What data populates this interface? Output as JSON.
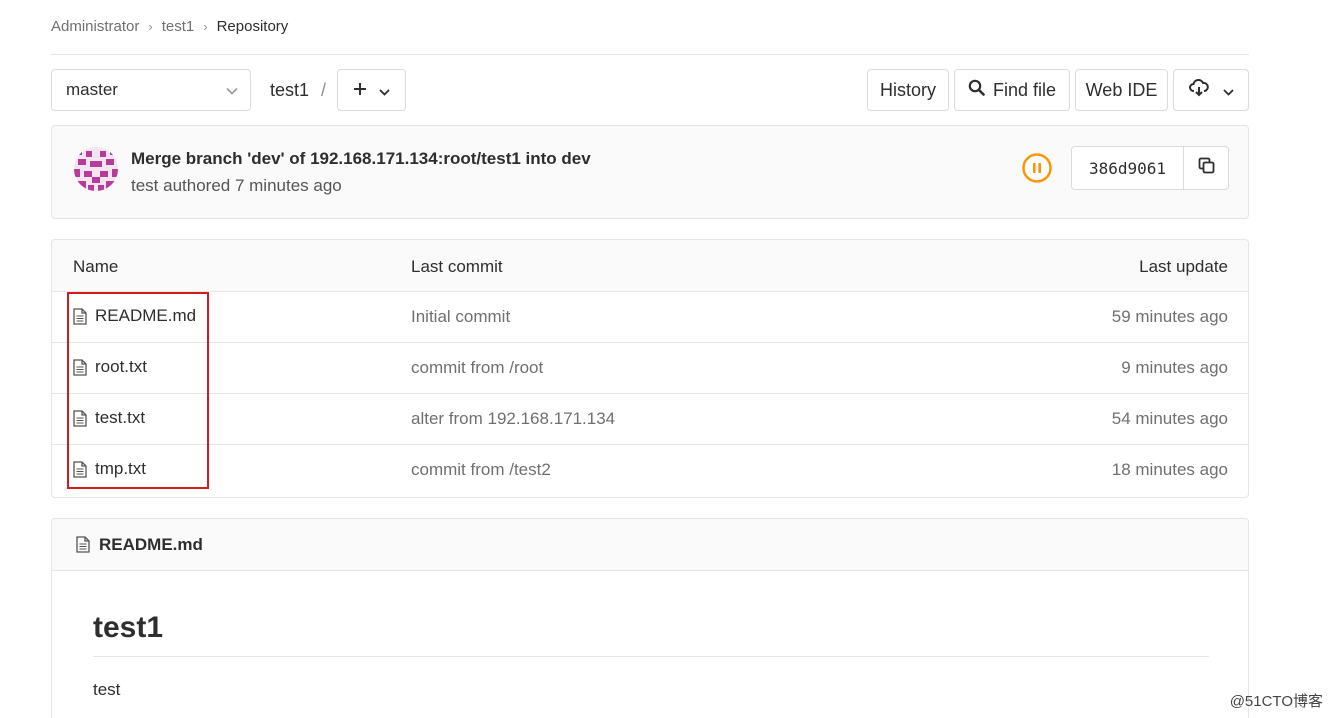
{
  "breadcrumb": {
    "items": [
      "Administrator",
      "test1"
    ],
    "current": "Repository"
  },
  "toolbar": {
    "branch": "master",
    "path_root": "test1",
    "path_sep": "/",
    "add_icon": "plus-icon",
    "history_label": "History",
    "find_file_label": "Find file",
    "web_ide_label": "Web IDE",
    "download_icon": "cloud-download-icon"
  },
  "commit": {
    "title": "Merge branch 'dev' of 192.168.171.134:root/test1 into dev",
    "author_line": "test authored 7 minutes ago",
    "pipeline_status": "paused",
    "pipeline_color": "#fc9403",
    "sha": "386d9061"
  },
  "table": {
    "headers": {
      "name": "Name",
      "last_commit": "Last commit",
      "last_update": "Last update"
    },
    "rows": [
      {
        "name": "README.md",
        "commit": "Initial commit",
        "updated": "59 minutes ago"
      },
      {
        "name": "root.txt",
        "commit": "commit from /root",
        "updated": "9 minutes ago"
      },
      {
        "name": "test.txt",
        "commit": "alter from 192.168.171.134",
        "updated": "54 minutes ago"
      },
      {
        "name": "tmp.txt",
        "commit": "commit from /test2",
        "updated": "18 minutes ago"
      }
    ]
  },
  "readme": {
    "filename": "README.md",
    "heading": "test1",
    "body": "test"
  },
  "highlight_color": "#d01c1c",
  "watermark": "@51CTO博客"
}
